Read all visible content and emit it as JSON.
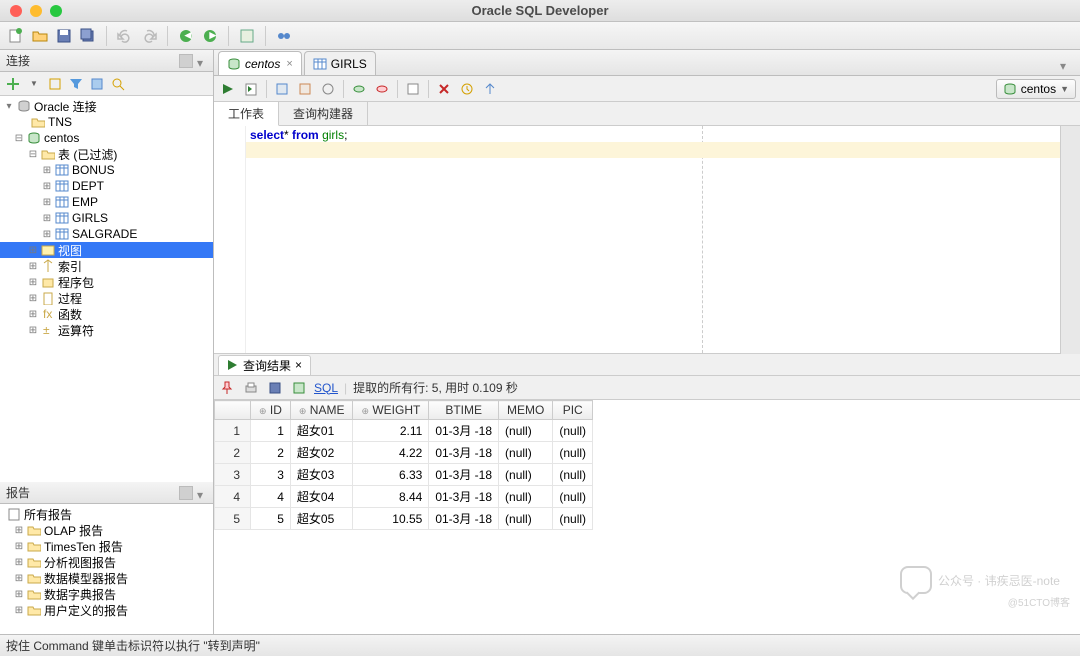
{
  "title": "Oracle SQL Developer",
  "left_panels": {
    "connections": {
      "title": "连接",
      "root": "Oracle 连接",
      "nodes": [
        {
          "label": "TNS",
          "icon": "folder"
        },
        {
          "label": "centos",
          "icon": "db",
          "expanded": true,
          "children": [
            {
              "label": "表 (已过滤)",
              "icon": "folder",
              "expanded": true,
              "children": [
                {
                  "label": "BONUS",
                  "icon": "table"
                },
                {
                  "label": "DEPT",
                  "icon": "table"
                },
                {
                  "label": "EMP",
                  "icon": "table"
                },
                {
                  "label": "GIRLS",
                  "icon": "table"
                },
                {
                  "label": "SALGRADE",
                  "icon": "table"
                }
              ]
            },
            {
              "label": "视图",
              "icon": "view",
              "selected": true
            },
            {
              "label": "索引",
              "icon": "index"
            },
            {
              "label": "程序包",
              "icon": "pkg"
            },
            {
              "label": "过程",
              "icon": "proc"
            },
            {
              "label": "函数",
              "icon": "func"
            },
            {
              "label": "运算符",
              "icon": "op"
            }
          ]
        }
      ]
    },
    "reports": {
      "title": "报告",
      "root": "所有报告",
      "items": [
        "OLAP 报告",
        "TimesTen 报告",
        "分析视图报告",
        "数据模型器报告",
        "数据字典报告",
        "用户定义的报告"
      ]
    }
  },
  "editor": {
    "tabs": [
      {
        "label": "centos",
        "icon": "db",
        "active": true
      },
      {
        "label": "GIRLS",
        "icon": "table",
        "active": false
      }
    ],
    "connection_selector": "centos",
    "sub_tabs": {
      "active": "工作表",
      "other": "查询构建器"
    },
    "sql": {
      "kw1": "select",
      "star": "*",
      "kw2": "from",
      "id": "girls",
      "semi": ";"
    }
  },
  "results": {
    "tab_label": "查询结果",
    "sql_link": "SQL",
    "fetch_text": "提取的所有行: 5, 用时 0.109 秒",
    "columns": [
      "ID",
      "NAME",
      "WEIGHT",
      "BTIME",
      "MEMO",
      "PIC"
    ],
    "rows": [
      {
        "n": 1,
        "ID": 1,
        "NAME": "超女01",
        "WEIGHT": "2.11",
        "BTIME": "01-3月 -18",
        "MEMO": "(null)",
        "PIC": "(null)"
      },
      {
        "n": 2,
        "ID": 2,
        "NAME": "超女02",
        "WEIGHT": "4.22",
        "BTIME": "01-3月 -18",
        "MEMO": "(null)",
        "PIC": "(null)"
      },
      {
        "n": 3,
        "ID": 3,
        "NAME": "超女03",
        "WEIGHT": "6.33",
        "BTIME": "01-3月 -18",
        "MEMO": "(null)",
        "PIC": "(null)"
      },
      {
        "n": 4,
        "ID": 4,
        "NAME": "超女04",
        "WEIGHT": "8.44",
        "BTIME": "01-3月 -18",
        "MEMO": "(null)",
        "PIC": "(null)"
      },
      {
        "n": 5,
        "ID": 5,
        "NAME": "超女05",
        "WEIGHT": "10.55",
        "BTIME": "01-3月 -18",
        "MEMO": "(null)",
        "PIC": "(null)"
      }
    ]
  },
  "statusbar": "按住 Command 键单击标识符以执行 \"转到声明\"",
  "watermark": "公众号 · 讳疾忌医-note",
  "watermark2": "@51CTO博客"
}
